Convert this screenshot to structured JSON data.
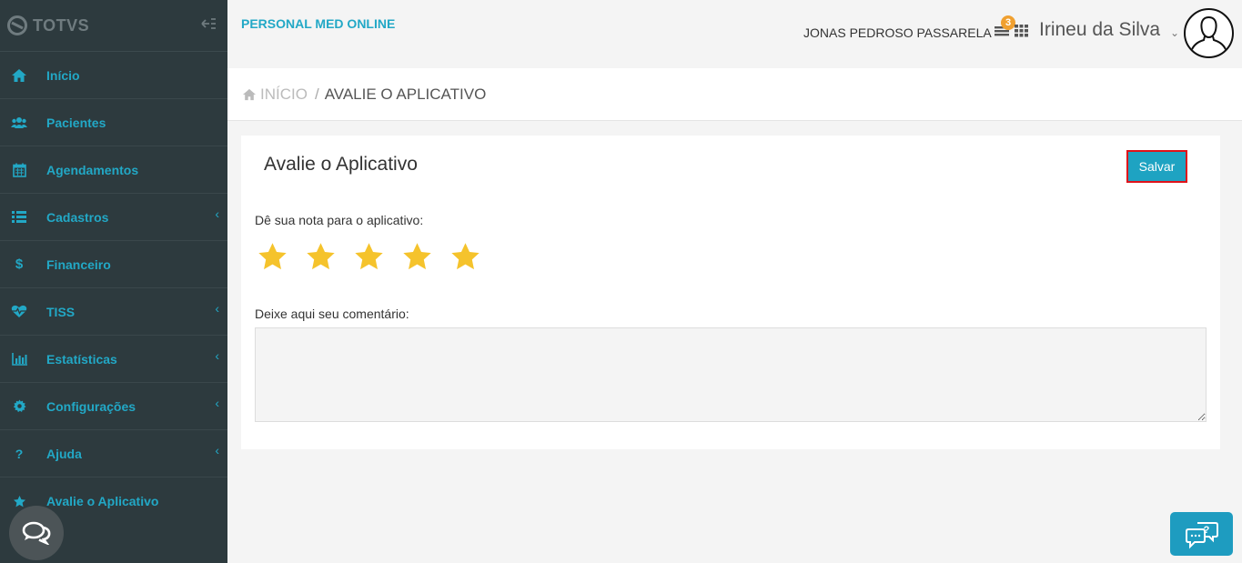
{
  "sidebar": {
    "logo_text": "TOTVS",
    "items": [
      {
        "label": "Início",
        "icon": "home-icon",
        "has_children": false
      },
      {
        "label": "Pacientes",
        "icon": "users-icon",
        "has_children": false
      },
      {
        "label": "Agendamentos",
        "icon": "calendar-icon",
        "has_children": false
      },
      {
        "label": "Cadastros",
        "icon": "list-icon",
        "has_children": true
      },
      {
        "label": "Financeiro",
        "icon": "dollar-icon",
        "has_children": false
      },
      {
        "label": "TISS",
        "icon": "heartbeat-icon",
        "has_children": true
      },
      {
        "label": "Estatísticas",
        "icon": "bar-chart-icon",
        "has_children": true
      },
      {
        "label": "Configurações",
        "icon": "gear-icon",
        "has_children": true
      },
      {
        "label": "Ajuda",
        "icon": "question-icon",
        "has_children": true
      },
      {
        "label": "Avalie o Aplicativo",
        "icon": "star-icon",
        "has_children": false
      }
    ]
  },
  "header": {
    "app_title": "PERSONAL MED ONLINE",
    "user_name": "JONAS PEDROSO PASSARELA",
    "notification_count": "3",
    "account_name": "Irineu da Silva",
    "account_chevron": "⌄"
  },
  "breadcrumb": {
    "home": "INÍCIO",
    "separator": "/",
    "current": "AVALIE O APLICATIVO"
  },
  "main": {
    "title": "Avalie o Aplicativo",
    "save_label": "Salvar",
    "rating_label": "Dê sua nota para o aplicativo:",
    "rating_value": 5,
    "rating_max": 5,
    "comment_label": "Deixe aqui seu comentário:",
    "comment_value": ""
  },
  "colors": {
    "accent": "#22a8c6",
    "sidebar_bg": "#2d3a3e",
    "star": "#f5c32c",
    "badge": "#f0a030",
    "save_border": "#e0121a"
  }
}
